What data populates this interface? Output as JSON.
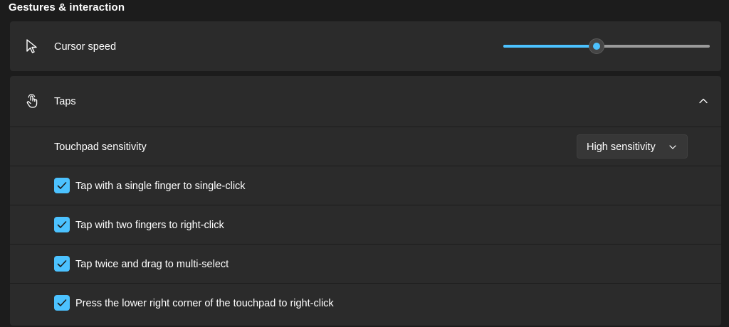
{
  "section": {
    "title": "Gestures & interaction"
  },
  "cursor_speed": {
    "label": "Cursor speed",
    "icon": "cursor-pointer-icon",
    "value": 0.45,
    "accent": "#4cc2ff"
  },
  "taps": {
    "label": "Taps",
    "icon": "tap-hand-icon",
    "expanded": true,
    "sensitivity": {
      "label": "Touchpad sensitivity",
      "selected": "High sensitivity"
    },
    "options": [
      {
        "label": "Tap with a single finger to single-click",
        "checked": true
      },
      {
        "label": "Tap with two fingers to right-click",
        "checked": true
      },
      {
        "label": "Tap twice and drag to multi-select",
        "checked": true
      },
      {
        "label": "Press the lower right corner of the touchpad to right-click",
        "checked": true
      }
    ]
  }
}
